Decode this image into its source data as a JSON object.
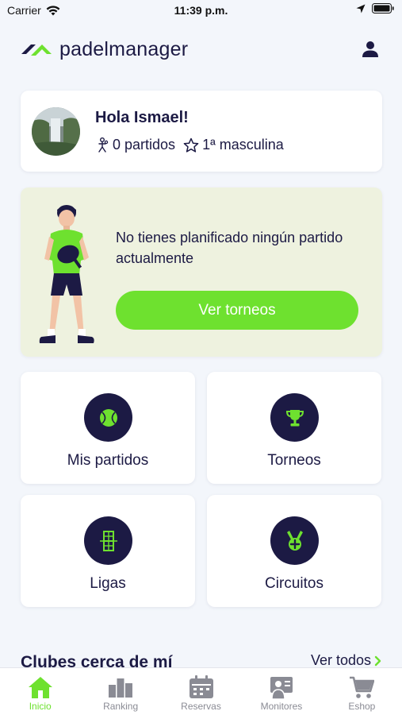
{
  "status_bar": {
    "carrier": "Carrier",
    "time": "11:39 p.m."
  },
  "header": {
    "brand": "padelmanager"
  },
  "greeting": {
    "title": "Hola Ismael!",
    "matches": "0 partidos",
    "category": "1ª masculina"
  },
  "promo": {
    "message": "No tienes planificado ningún partido actualmente",
    "button_label": "Ver torneos"
  },
  "tiles": [
    {
      "label": "Mis partidos",
      "icon": "tennis-ball-icon"
    },
    {
      "label": "Torneos",
      "icon": "trophy-icon"
    },
    {
      "label": "Ligas",
      "icon": "court-icon"
    },
    {
      "label": "Circuitos",
      "icon": "medal-icon"
    }
  ],
  "nearby": {
    "title": "Clubes cerca de mí",
    "see_all": "Ver todos"
  },
  "tab_bar": {
    "items": [
      {
        "label": "Inicio",
        "icon": "home-icon",
        "active": true
      },
      {
        "label": "Ranking",
        "icon": "ranking-icon",
        "active": false
      },
      {
        "label": "Reservas",
        "icon": "calendar-icon",
        "active": false
      },
      {
        "label": "Monitores",
        "icon": "instructor-icon",
        "active": false
      },
      {
        "label": "Eshop",
        "icon": "cart-icon",
        "active": false
      }
    ]
  },
  "colors": {
    "brand_navy": "#1c1a44",
    "accent_green": "#6ee12f",
    "background": "#f3f6fb",
    "promo_background": "#eef2df",
    "inactive_tab": "#8a8b94"
  }
}
